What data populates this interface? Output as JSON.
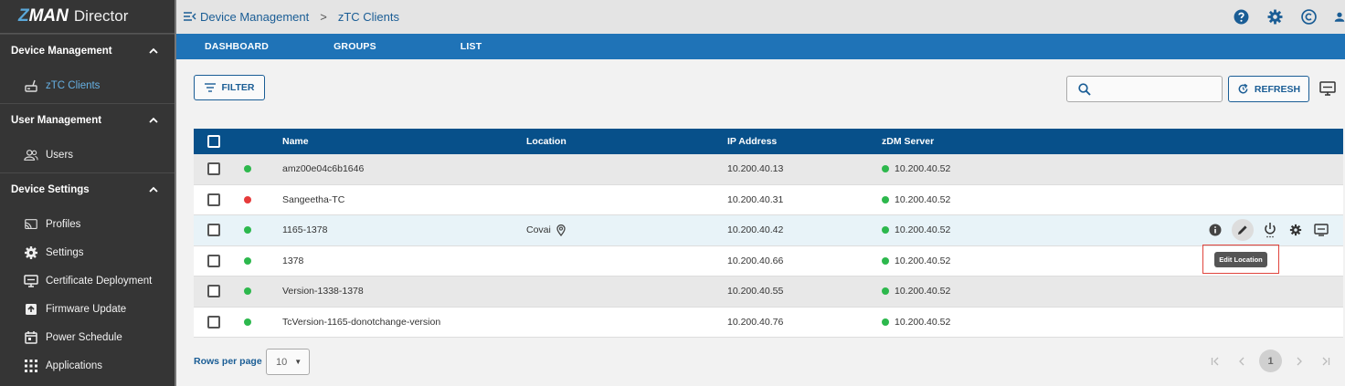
{
  "app": {
    "logo_z": "Z",
    "logo_man": "MAN",
    "logo_product": "Director"
  },
  "sidebar": {
    "sections": [
      {
        "title": "Device Management",
        "items": [
          {
            "label": "zTC Clients",
            "icon": "thin-client-icon",
            "active": true
          }
        ]
      },
      {
        "title": "User Management",
        "items": [
          {
            "label": "Users",
            "icon": "users-icon"
          }
        ]
      },
      {
        "title": "Device Settings",
        "items": [
          {
            "label": "Profiles",
            "icon": "cast-icon"
          },
          {
            "label": "Settings",
            "icon": "gear-icon"
          },
          {
            "label": "Certificate Deployment",
            "icon": "monitor-icon"
          },
          {
            "label": "Firmware Update",
            "icon": "upload-icon"
          },
          {
            "label": "Power Schedule",
            "icon": "calendar-icon"
          },
          {
            "label": "Applications",
            "icon": "grid-icon"
          }
        ]
      }
    ]
  },
  "breadcrumb": {
    "parent": "Device Management",
    "separator": ">",
    "current": "zTC Clients"
  },
  "tabs": [
    "DASHBOARD",
    "GROUPS",
    "LIST"
  ],
  "toolbar": {
    "filter_label": "FILTER",
    "refresh_label": "REFRESH",
    "search_placeholder": ""
  },
  "table": {
    "headers": {
      "name": "Name",
      "location": "Location",
      "ip": "IP Address",
      "server": "zDM Server"
    },
    "rows": [
      {
        "status": "online",
        "name": "amz00e04c6b1646",
        "location": "",
        "ip": "10.200.40.13",
        "server": "10.200.40.52"
      },
      {
        "status": "offline",
        "name": "Sangeetha-TC",
        "location": "",
        "ip": "10.200.40.31",
        "server": "10.200.40.52"
      },
      {
        "status": "online",
        "name": "1165-1378",
        "location": "Covai",
        "ip": "10.200.40.42",
        "server": "10.200.40.52"
      },
      {
        "status": "online",
        "name": "1378",
        "location": "",
        "ip": "10.200.40.66",
        "server": "10.200.40.52"
      },
      {
        "status": "online",
        "name": "Version-1338-1378",
        "location": "",
        "ip": "10.200.40.55",
        "server": "10.200.40.52"
      },
      {
        "status": "online",
        "name": "TcVersion-1165-donotchange-version",
        "location": "",
        "ip": "10.200.40.76",
        "server": "10.200.40.52"
      }
    ]
  },
  "tooltip": "Edit Location",
  "pagination": {
    "rows_label": "Rows per page",
    "rows_value": "10",
    "current_page": "1"
  },
  "colors": {
    "online": "#2db84d",
    "offline": "#e63b3b",
    "accent": "#1f73b7",
    "header": "#07508a"
  }
}
